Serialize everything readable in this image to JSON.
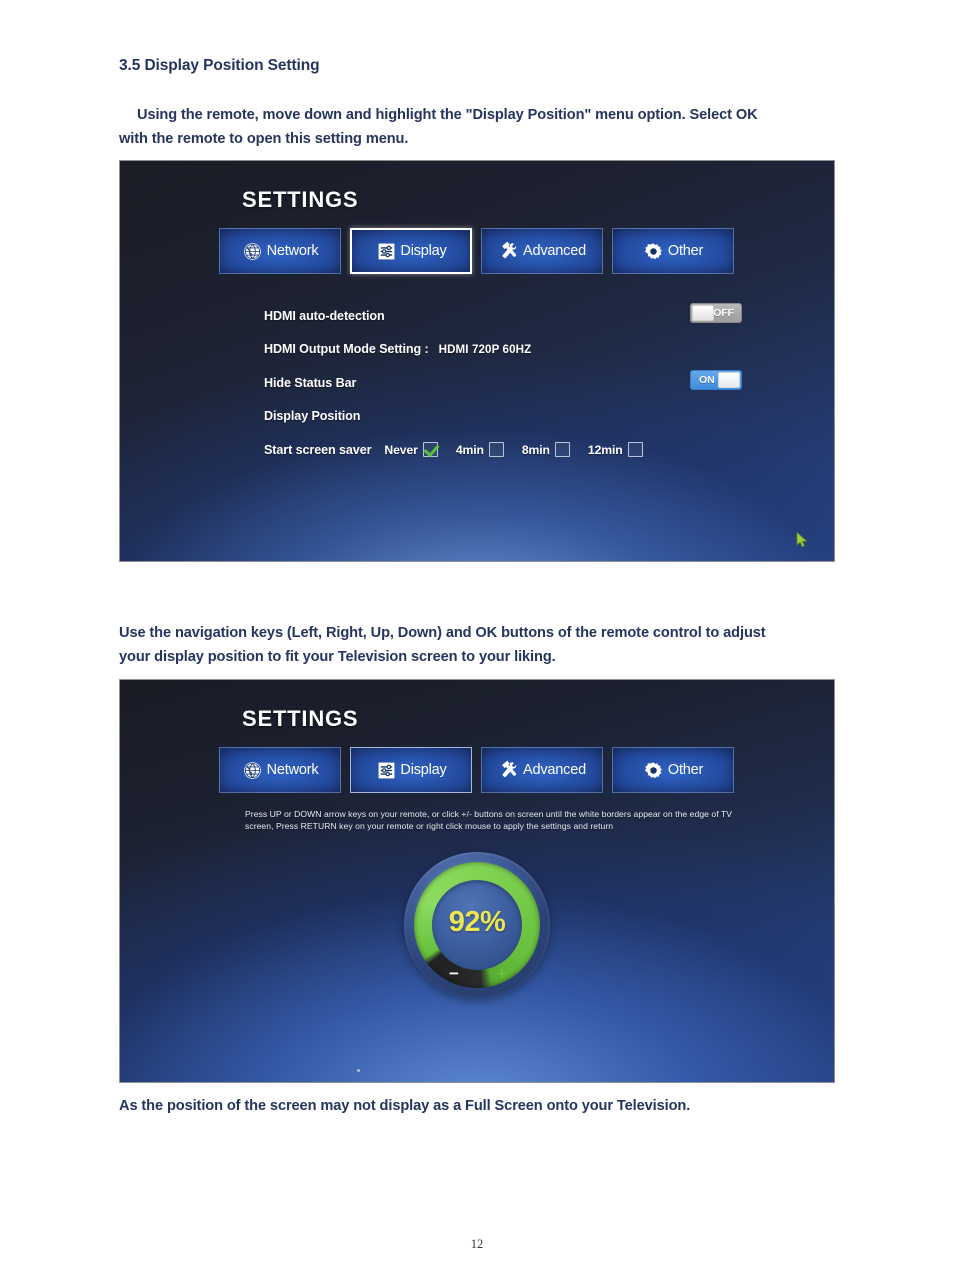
{
  "document": {
    "heading": "3.5 Display Position Setting",
    "intro_line1": "Using the remote, move down and highlight the \"Display Position\" menu option.    Select OK",
    "intro_line2": "with the remote to open this setting menu.",
    "middle_line1": "Use the navigation keys (Left, Right, Up, Down) and OK buttons of the remote control to adjust",
    "middle_line2": "your display position to fit your Television screen to your liking.",
    "bottom_line1": "As the position of the screen may not display as a Full Screen onto your Television.",
    "page_number": "12",
    "text_color": "#25355e"
  },
  "screen_one": {
    "title": "SETTINGS",
    "tabs": [
      {
        "label": "Network",
        "icon": "globe-icon",
        "selected": false
      },
      {
        "label": "Display",
        "icon": "sliders-icon",
        "selected": true
      },
      {
        "label": "Advanced",
        "icon": "tools-icon",
        "selected": false
      },
      {
        "label": "Other",
        "icon": "gear-icon",
        "selected": false
      }
    ],
    "rows": {
      "hdmi_auto_detection_label": "HDMI auto-detection",
      "hdmi_auto_detection_state": "OFF",
      "hdmi_output_mode_label": "HDMI Output Mode Setting :",
      "hdmi_output_mode_value": "HDMI 720P 60HZ",
      "hide_status_bar_label": "Hide Status Bar",
      "hide_status_bar_state": "ON",
      "display_position_label": "Display Position",
      "screen_saver_label": "Start screen saver"
    },
    "screen_saver_options": [
      {
        "label": "Never",
        "checked": true
      },
      {
        "label": "4min",
        "checked": false
      },
      {
        "label": "8min",
        "checked": false
      },
      {
        "label": "12min",
        "checked": false
      }
    ],
    "cursor": "green-arrow-cursor"
  },
  "screen_two": {
    "title": "SETTINGS",
    "tabs": [
      {
        "label": "Network",
        "icon": "globe-icon",
        "selected": false
      },
      {
        "label": "Display",
        "icon": "sliders-icon",
        "selected": true
      },
      {
        "label": "Advanced",
        "icon": "tools-icon",
        "selected": false
      },
      {
        "label": "Other",
        "icon": "gear-icon",
        "selected": false
      }
    ],
    "hint": "Press UP or DOWN arrow keys on your remote, or click +/- buttons on screen until the white borders appear on the edge of TV screen, Press RETURN key on your remote or right click mouse to apply the settings and return",
    "gauge": {
      "value": "92%",
      "percent": 92,
      "decrease_label": "−",
      "increase_label": "+",
      "fill_color": "#7ed04f",
      "value_color": "#ebe550",
      "empty_color": "#222324"
    }
  }
}
